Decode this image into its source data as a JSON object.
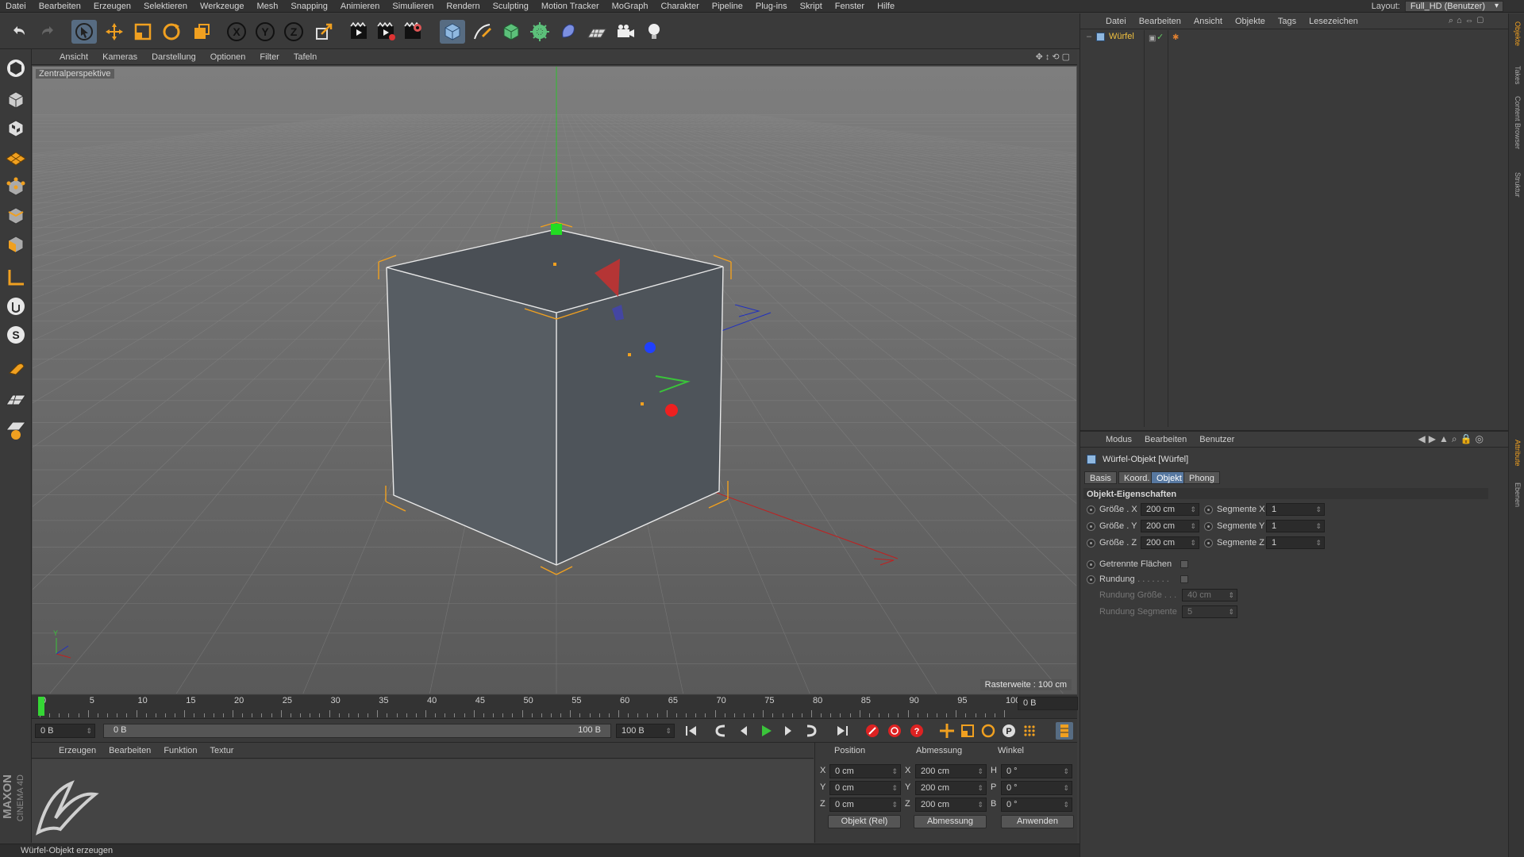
{
  "menubar": {
    "items": [
      "Datei",
      "Bearbeiten",
      "Erzeugen",
      "Selektieren",
      "Werkzeuge",
      "Mesh",
      "Snapping",
      "Animieren",
      "Simulieren",
      "Rendern",
      "Sculpting",
      "Motion Tracker",
      "MoGraph",
      "Charakter",
      "Pipeline",
      "Plug-ins",
      "Skript",
      "Fenster",
      "Hilfe"
    ],
    "layout_label": "Layout:",
    "layout_value": "Full_HD (Benutzer)"
  },
  "viewport": {
    "menu": [
      "Ansicht",
      "Kameras",
      "Darstellung",
      "Optionen",
      "Filter",
      "Tafeln"
    ],
    "camera_label": "Zentralperspektive",
    "grid_label": "Rasterweite : 100 cm"
  },
  "timeline": {
    "ticks": [
      "0",
      "5",
      "10",
      "15",
      "20",
      "25",
      "30",
      "35",
      "40",
      "45",
      "50",
      "55",
      "60",
      "65",
      "70",
      "75",
      "80",
      "85",
      "90",
      "95",
      "100"
    ],
    "current_frame_right": "0 B"
  },
  "playbar": {
    "start": "0 B",
    "range_start": "0 B",
    "range_end": "100 B",
    "end": "100 B"
  },
  "material_manager": {
    "menu": [
      "Erzeugen",
      "Bearbeiten",
      "Funktion",
      "Textur"
    ]
  },
  "coordinates": {
    "headers": [
      "Position",
      "Abmessung",
      "Winkel"
    ],
    "rows": [
      {
        "axis": "X",
        "pos": "0 cm",
        "size_axis": "X",
        "size": "200 cm",
        "rot_axis": "H",
        "rot": "0 °"
      },
      {
        "axis": "Y",
        "pos": "0 cm",
        "size_axis": "Y",
        "size": "200 cm",
        "rot_axis": "P",
        "rot": "0 °"
      },
      {
        "axis": "Z",
        "pos": "0 cm",
        "size_axis": "Z",
        "size": "200 cm",
        "rot_axis": "B",
        "rot": "0 °"
      }
    ],
    "mode_select": "Objekt (Rel)",
    "size_select": "Abmessung",
    "apply_label": "Anwenden"
  },
  "status": "Würfel-Objekt erzeugen",
  "brand": {
    "maxon": "MAXON",
    "cinema": "CINEMA 4D"
  },
  "object_manager": {
    "menu": [
      "Datei",
      "Bearbeiten",
      "Ansicht",
      "Objekte",
      "Tags",
      "Lesezeichen"
    ],
    "objects": [
      {
        "name": "Würfel"
      }
    ]
  },
  "attribute_manager": {
    "menu": [
      "Modus",
      "Bearbeiten",
      "Benutzer"
    ],
    "title": "Würfel-Objekt [Würfel]",
    "tabs": [
      {
        "label": "Basis",
        "active": false
      },
      {
        "label": "Koord.",
        "active": false
      },
      {
        "label": "Objekt",
        "active": true
      },
      {
        "label": "Phong",
        "active": false
      }
    ],
    "section": "Objekt-Eigenschaften",
    "size_props": [
      {
        "label": "Größe . X",
        "value": "200 cm",
        "seg_label": "Segmente X",
        "seg_value": "1"
      },
      {
        "label": "Größe . Y",
        "value": "200 cm",
        "seg_label": "Segmente Y",
        "seg_value": "1"
      },
      {
        "label": "Größe . Z",
        "value": "200 cm",
        "seg_label": "Segmente Z",
        "seg_value": "1"
      }
    ],
    "separate_faces": "Getrennte Flächen",
    "fillet": "Rundung",
    "fillet_dots": ". . . . . . . .",
    "fillet_size_label": "Rundung Größe . . .",
    "fillet_size_value": "40 cm",
    "fillet_seg_label": "Rundung Segmente",
    "fillet_seg_value": "5"
  },
  "side_tabs": {
    "top": [
      "Objekte",
      "Takes",
      "Content Browser",
      "Struktur"
    ],
    "bottom": [
      "Attribute",
      "Ebenen"
    ]
  },
  "colors": {
    "accent": "#576c82",
    "tab_active": "#5778a0",
    "object_name": "#f0c040"
  }
}
